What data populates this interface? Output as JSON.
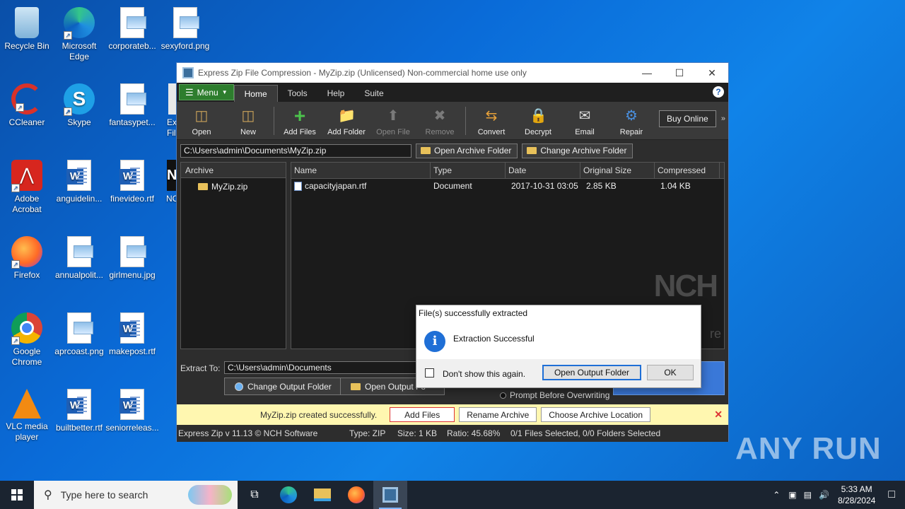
{
  "desktop": {
    "icons": [
      {
        "label": "Recycle Bin"
      },
      {
        "label": "Microsoft Edge"
      },
      {
        "label": "corporateb..."
      },
      {
        "label": "sexyford.png"
      },
      {
        "label": "CCleaner"
      },
      {
        "label": "Skype"
      },
      {
        "label": "fantasypet..."
      },
      {
        "label": "Exp File"
      },
      {
        "label": "Adobe Acrobat"
      },
      {
        "label": "anguidelin..."
      },
      {
        "label": "finevideo.rtf"
      },
      {
        "label": "NC"
      },
      {
        "label": "Firefox"
      },
      {
        "label": "annualpolit..."
      },
      {
        "label": "girlmenu.jpg"
      },
      {
        "label": "Google Chrome"
      },
      {
        "label": "aprcoast.png"
      },
      {
        "label": "makepost.rtf"
      },
      {
        "label": "VLC media player"
      },
      {
        "label": "builtbetter.rtf"
      },
      {
        "label": "seniorreleas..."
      }
    ]
  },
  "window": {
    "title": "Express Zip File Compression - MyZip.zip (Unlicensed) Non-commercial home use only",
    "menu_label": "Menu",
    "tabs": [
      {
        "label": "Home"
      },
      {
        "label": "Tools"
      },
      {
        "label": "Help"
      },
      {
        "label": "Suite"
      }
    ],
    "toolbar": [
      {
        "label": "Open"
      },
      {
        "label": "New"
      },
      {
        "label": "Add Files"
      },
      {
        "label": "Add Folder"
      },
      {
        "label": "Open File"
      },
      {
        "label": "Remove"
      },
      {
        "label": "Convert"
      },
      {
        "label": "Decrypt"
      },
      {
        "label": "Email"
      },
      {
        "label": "Repair"
      }
    ],
    "buy_online": "Buy Online",
    "archive_path": "C:\\Users\\admin\\Documents\\MyZip.zip",
    "open_archive_folder": "Open Archive Folder",
    "change_archive_folder": "Change Archive Folder",
    "tree": {
      "header": "Archive",
      "item": "MyZip.zip"
    },
    "columns": [
      "Name",
      "Type",
      "Date",
      "Original Size",
      "Compressed"
    ],
    "rows": [
      {
        "name": "capacityjapan.rtf",
        "type": "Document",
        "date": "2017-10-31 03:05",
        "original": "2.85 KB",
        "compressed": "1.04 KB"
      }
    ],
    "watermark": "NCH",
    "watermark_tail": "re",
    "extract_to_label": "Extract To:",
    "extract_path": "C:\\Users\\admin\\Documents",
    "change_output_folder": "Change Output Folder",
    "open_output_folder": "Open Output Fo",
    "prompt_overwrite": "Prompt Before Overwriting",
    "notice": {
      "text": "MyZip.zip created successfully.",
      "add_files": "Add Files",
      "rename_archive": "Rename Archive",
      "choose_location": "Choose Archive Location"
    },
    "status": {
      "version": "Express Zip v 11.13 © NCH Software",
      "type": "Type: ZIP",
      "size": "Size: 1 KB",
      "ratio": "Ratio: 45.68%",
      "selection": "0/1 Files Selected, 0/0 Folders Selected"
    }
  },
  "dialog": {
    "title": "File(s) successfully extracted",
    "message": "Extraction Successful",
    "checkbox_label": "Don't show this again.",
    "open_output_button": "Open Output Folder",
    "ok_button": "OK"
  },
  "taskbar": {
    "search_placeholder": "Type here to search",
    "time": "5:33 AM",
    "date": "8/28/2024"
  },
  "watermark": "ANY RUN",
  "colors": {
    "accent_green": "#2d7d2d",
    "notice_bg": "#fff7b0",
    "dialog_primary": "#1f6fd6"
  }
}
